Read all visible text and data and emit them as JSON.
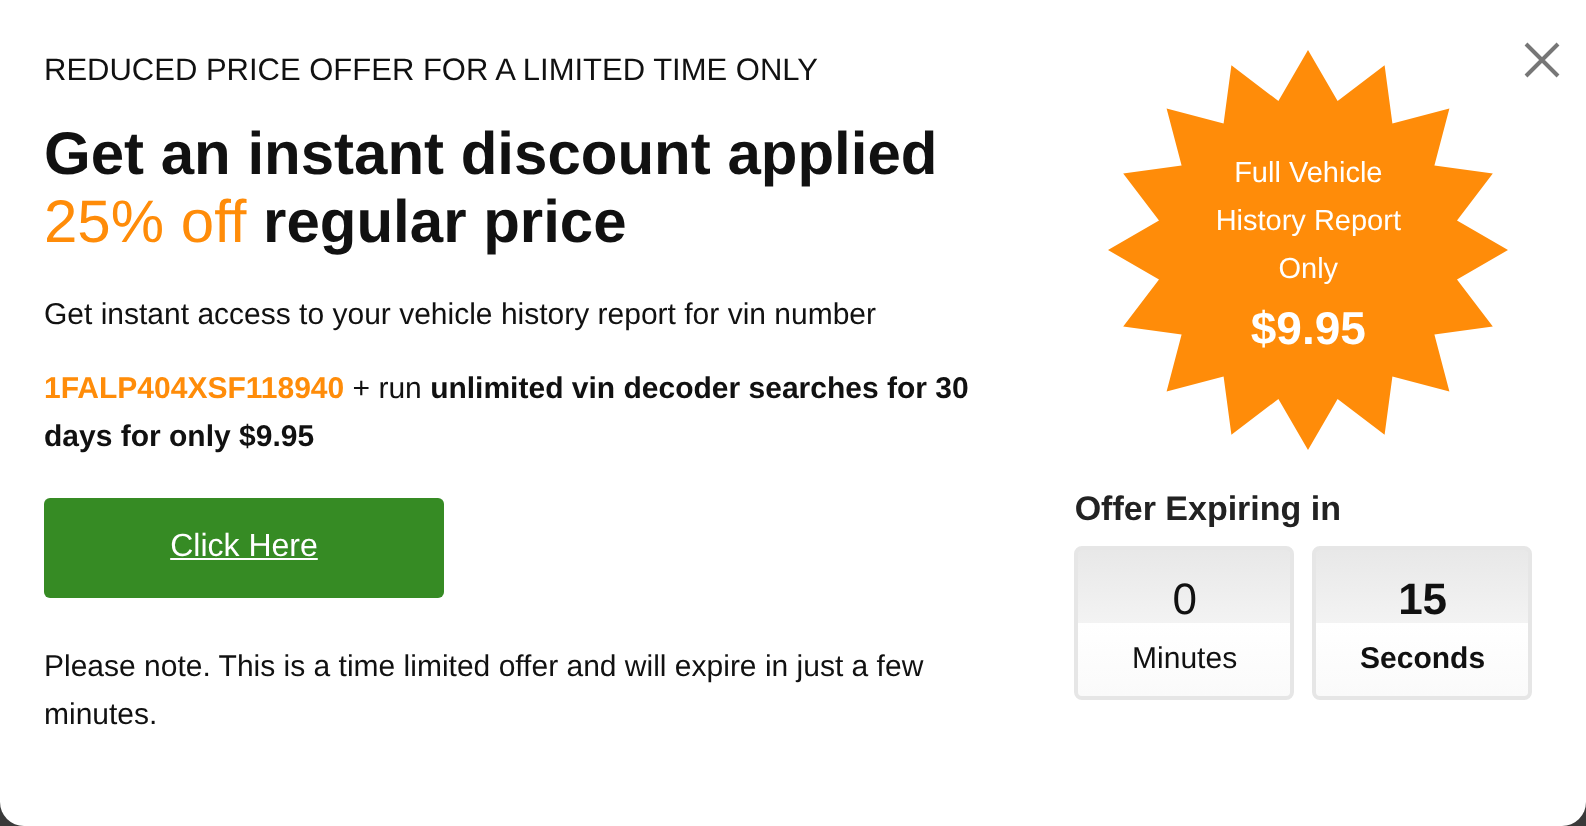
{
  "eyebrow": "REDUCED PRICE OFFER FOR A LIMITED TIME ONLY",
  "headline": {
    "lead": "Get an instant discount applied",
    "highlight": "25% off",
    "trail": "regular price"
  },
  "intro": "Get instant access to your vehicle history report for vin number",
  "details": [
    {
      "kind": "vin",
      "text": "1FALP404XSF118940"
    },
    {
      "kind": "plain",
      "text": " + run "
    },
    {
      "kind": "bold",
      "text": "unlimited vin decoder searches for 30 days for only $9.95"
    }
  ],
  "cta_button": "Click Here",
  "note": "Please note. This is a time limited offer and will expire in just a few minutes.",
  "badge": {
    "lines": [
      "Full Vehicle",
      "History Report",
      "Only"
    ],
    "price": "$9.95"
  },
  "countdown": {
    "title": "Offer Expiring in",
    "units": [
      {
        "value": "0",
        "label": "Minutes",
        "highlighted": false
      },
      {
        "value": "15",
        "label": "Seconds",
        "highlighted": true
      }
    ]
  }
}
